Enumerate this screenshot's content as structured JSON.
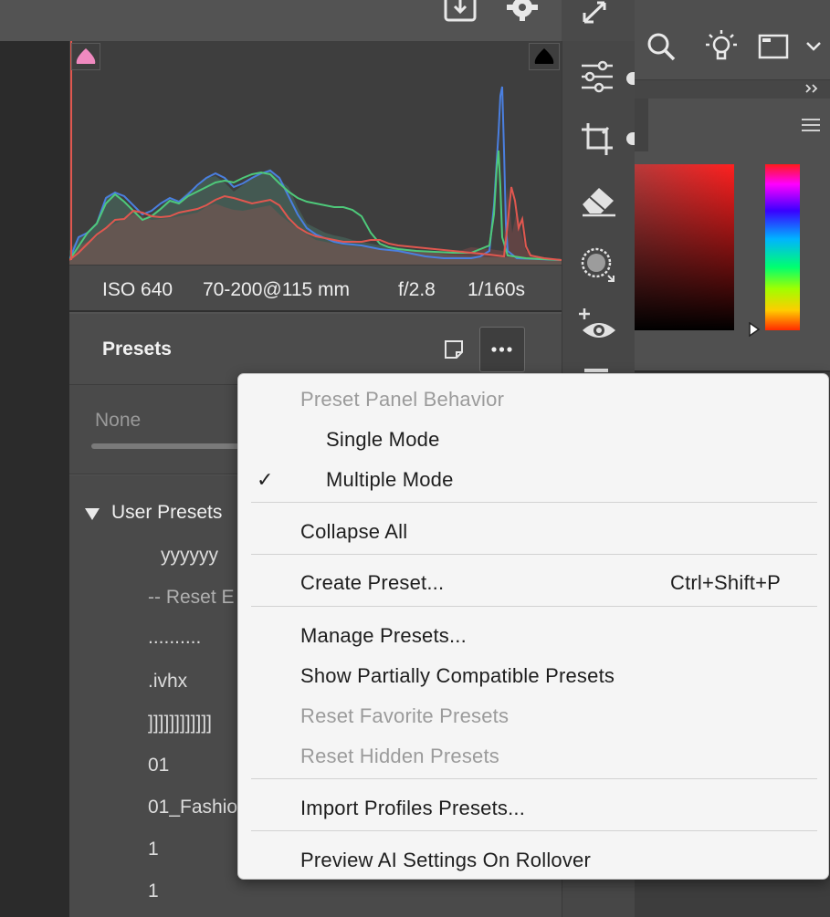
{
  "histogram": {
    "clip_shadow_color": "#f08ac0",
    "clip_highlight_color": "#000000"
  },
  "exif": {
    "iso": "ISO 640",
    "lens": "70-200@115 mm",
    "aperture": "f/2.8",
    "shutter": "1/160s"
  },
  "presets_panel": {
    "title": "Presets",
    "amount_label": "None",
    "group_label": "User Presets",
    "items": [
      "yyyyyy",
      "-- Reset E",
      "..........",
      ".ivhx",
      "]]]]]]]]]]]]",
      "01",
      "01_Fashio",
      "1",
      "1"
    ]
  },
  "context_menu": {
    "section_header": "Preset Panel Behavior",
    "single_mode": "Single Mode",
    "multiple_mode": "Multiple Mode",
    "checkmark": "✓",
    "collapse_all": "Collapse All",
    "create_preset": "Create Preset...",
    "create_preset_shortcut": "Ctrl+Shift+P",
    "manage_presets": "Manage Presets...",
    "show_partially_compatible": "Show Partially Compatible Presets",
    "reset_favorite": "Reset Favorite Presets",
    "reset_hidden": "Reset Hidden Presets",
    "import_profiles": "Import Profiles  Presets...",
    "preview_ai": "Preview AI Settings On Rollover"
  },
  "icons": {
    "top_bar": [
      "download-icon",
      "gear-icon",
      "expand-icon"
    ],
    "tool_column": [
      "sliders-icon",
      "crop-icon",
      "eraser-icon",
      "masking-icon",
      "redeye-icon"
    ],
    "right_bar": [
      "search-icon",
      "lightbulb-icon",
      "panel-icon",
      "chevron-down-icon",
      "double-chevron-icon",
      "hamburger-menu-icon"
    ],
    "presets": [
      "new-preset-icon",
      "more-options-icon",
      "disclosure-triangle-icon",
      "checkmark-icon"
    ]
  },
  "colors": {
    "menu_background": "#f5f5f5",
    "menu_disabled_text": "#9b9b9b",
    "panel_background": "#4a4a4a",
    "histogram_red": "#e0574f",
    "histogram_green": "#4ec97a",
    "histogram_blue": "#4a7fe0"
  }
}
